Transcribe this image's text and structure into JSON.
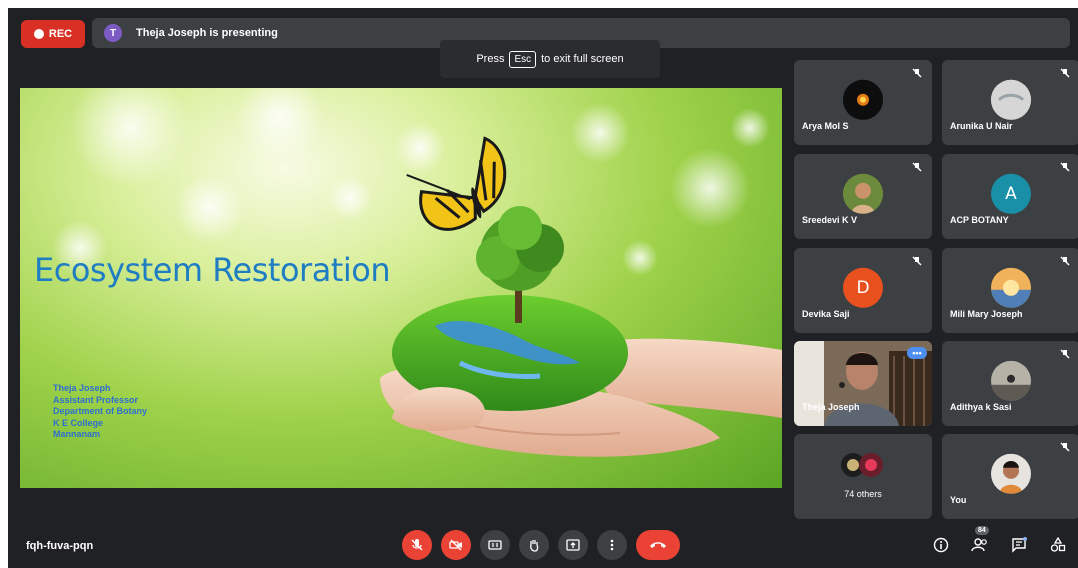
{
  "recording": {
    "label": "REC"
  },
  "presenter_bar": {
    "avatar_initial": "T",
    "text": "Theja Joseph is presenting"
  },
  "fullscreen_hint": {
    "before": "Press",
    "key": "Esc",
    "after": "to exit full screen"
  },
  "slide": {
    "title": "Ecosystem Restoration",
    "credits": [
      "Theja Joseph",
      "Assistant Professor",
      "Department of Botany",
      "K E College",
      "Mannanam"
    ]
  },
  "participants": [
    {
      "name": "Arya Mol S"
    },
    {
      "name": "Arunika U Nair"
    },
    {
      "name": "Sreedevi K V"
    },
    {
      "name": "ACP BOTANY",
      "initial": "A",
      "color": "#1a8fa8"
    },
    {
      "name": "Devika Saji",
      "initial": "D",
      "color": "#e8501e"
    },
    {
      "name": "Mili Mary Joseph"
    },
    {
      "name": "Theja Joseph",
      "more": "•••"
    },
    {
      "name": "Adithya k Sasi"
    },
    {
      "name": "74 others"
    },
    {
      "name": "You"
    }
  ],
  "meeting_code": "fqh-fuva-pqn",
  "people_count": "84",
  "controls": [
    "microphone-off",
    "camera-off",
    "captions",
    "raise-hand",
    "present",
    "more-options",
    "leave-call"
  ],
  "right_controls": [
    "meeting-details",
    "people",
    "chat",
    "activities"
  ],
  "colors": {
    "background": "#202124",
    "tile": "#3c4043",
    "danger": "#ea4335",
    "active_border": "#8ab4f8",
    "title": "#1f7dc4"
  }
}
